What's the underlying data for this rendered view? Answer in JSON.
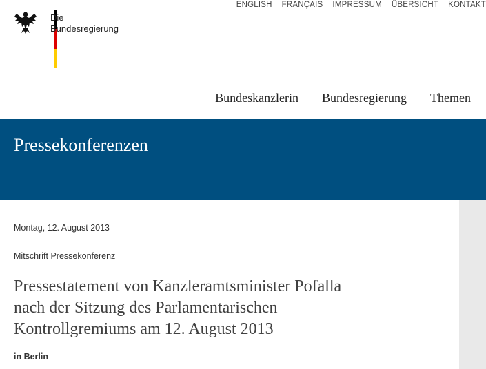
{
  "logo": {
    "line1": "Die",
    "line2": "Bundesregierung",
    "flag_colors": [
      "#000000",
      "#dd0000",
      "#ffcc00"
    ]
  },
  "meta_nav": {
    "items": [
      "ENGLISH",
      "FRANÇAIS",
      "IMPRESSUM",
      "ÜBERSICHT",
      "KONTAKT"
    ]
  },
  "main_nav": {
    "items": [
      "Bundeskanzlerin",
      "Bundesregierung",
      "Themen"
    ]
  },
  "banner": {
    "title": "Pressekonferenzen",
    "color": "#004f80"
  },
  "article": {
    "date": "Montag, 12. August 2013",
    "category": "Mitschrift Pressekonferenz",
    "headline_lines": [
      "Pressestatement von Kanzleramtsminister Pofalla",
      "nach der Sitzung des Parlamentarischen",
      "Kontrollgremiums am 12. August 2013"
    ],
    "location": "in Berlin"
  }
}
